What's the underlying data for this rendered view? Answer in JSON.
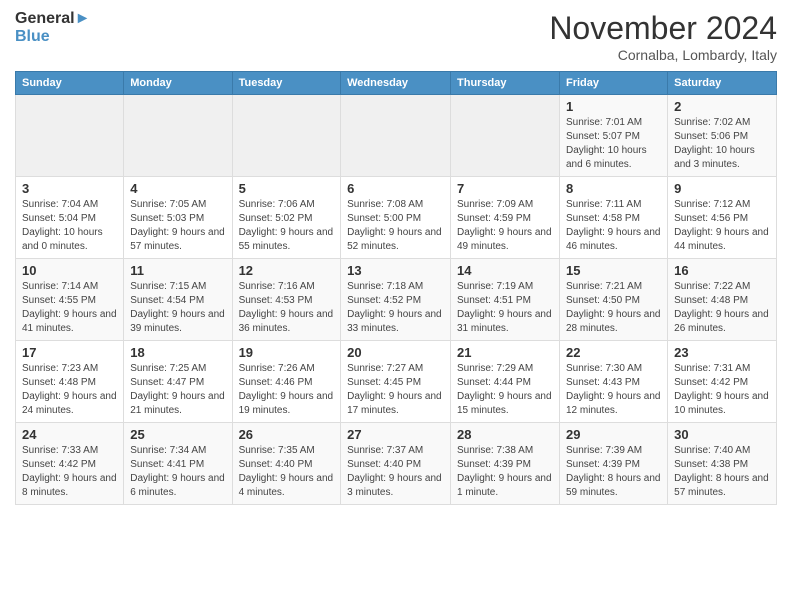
{
  "logo": {
    "line1": "General",
    "line2": "Blue"
  },
  "title": "November 2024",
  "subtitle": "Cornalba, Lombardy, Italy",
  "days_of_week": [
    "Sunday",
    "Monday",
    "Tuesday",
    "Wednesday",
    "Thursday",
    "Friday",
    "Saturday"
  ],
  "weeks": [
    [
      {
        "num": "",
        "info": ""
      },
      {
        "num": "",
        "info": ""
      },
      {
        "num": "",
        "info": ""
      },
      {
        "num": "",
        "info": ""
      },
      {
        "num": "",
        "info": ""
      },
      {
        "num": "1",
        "info": "Sunrise: 7:01 AM\nSunset: 5:07 PM\nDaylight: 10 hours and 6 minutes."
      },
      {
        "num": "2",
        "info": "Sunrise: 7:02 AM\nSunset: 5:06 PM\nDaylight: 10 hours and 3 minutes."
      }
    ],
    [
      {
        "num": "3",
        "info": "Sunrise: 7:04 AM\nSunset: 5:04 PM\nDaylight: 10 hours and 0 minutes."
      },
      {
        "num": "4",
        "info": "Sunrise: 7:05 AM\nSunset: 5:03 PM\nDaylight: 9 hours and 57 minutes."
      },
      {
        "num": "5",
        "info": "Sunrise: 7:06 AM\nSunset: 5:02 PM\nDaylight: 9 hours and 55 minutes."
      },
      {
        "num": "6",
        "info": "Sunrise: 7:08 AM\nSunset: 5:00 PM\nDaylight: 9 hours and 52 minutes."
      },
      {
        "num": "7",
        "info": "Sunrise: 7:09 AM\nSunset: 4:59 PM\nDaylight: 9 hours and 49 minutes."
      },
      {
        "num": "8",
        "info": "Sunrise: 7:11 AM\nSunset: 4:58 PM\nDaylight: 9 hours and 46 minutes."
      },
      {
        "num": "9",
        "info": "Sunrise: 7:12 AM\nSunset: 4:56 PM\nDaylight: 9 hours and 44 minutes."
      }
    ],
    [
      {
        "num": "10",
        "info": "Sunrise: 7:14 AM\nSunset: 4:55 PM\nDaylight: 9 hours and 41 minutes."
      },
      {
        "num": "11",
        "info": "Sunrise: 7:15 AM\nSunset: 4:54 PM\nDaylight: 9 hours and 39 minutes."
      },
      {
        "num": "12",
        "info": "Sunrise: 7:16 AM\nSunset: 4:53 PM\nDaylight: 9 hours and 36 minutes."
      },
      {
        "num": "13",
        "info": "Sunrise: 7:18 AM\nSunset: 4:52 PM\nDaylight: 9 hours and 33 minutes."
      },
      {
        "num": "14",
        "info": "Sunrise: 7:19 AM\nSunset: 4:51 PM\nDaylight: 9 hours and 31 minutes."
      },
      {
        "num": "15",
        "info": "Sunrise: 7:21 AM\nSunset: 4:50 PM\nDaylight: 9 hours and 28 minutes."
      },
      {
        "num": "16",
        "info": "Sunrise: 7:22 AM\nSunset: 4:48 PM\nDaylight: 9 hours and 26 minutes."
      }
    ],
    [
      {
        "num": "17",
        "info": "Sunrise: 7:23 AM\nSunset: 4:48 PM\nDaylight: 9 hours and 24 minutes."
      },
      {
        "num": "18",
        "info": "Sunrise: 7:25 AM\nSunset: 4:47 PM\nDaylight: 9 hours and 21 minutes."
      },
      {
        "num": "19",
        "info": "Sunrise: 7:26 AM\nSunset: 4:46 PM\nDaylight: 9 hours and 19 minutes."
      },
      {
        "num": "20",
        "info": "Sunrise: 7:27 AM\nSunset: 4:45 PM\nDaylight: 9 hours and 17 minutes."
      },
      {
        "num": "21",
        "info": "Sunrise: 7:29 AM\nSunset: 4:44 PM\nDaylight: 9 hours and 15 minutes."
      },
      {
        "num": "22",
        "info": "Sunrise: 7:30 AM\nSunset: 4:43 PM\nDaylight: 9 hours and 12 minutes."
      },
      {
        "num": "23",
        "info": "Sunrise: 7:31 AM\nSunset: 4:42 PM\nDaylight: 9 hours and 10 minutes."
      }
    ],
    [
      {
        "num": "24",
        "info": "Sunrise: 7:33 AM\nSunset: 4:42 PM\nDaylight: 9 hours and 8 minutes."
      },
      {
        "num": "25",
        "info": "Sunrise: 7:34 AM\nSunset: 4:41 PM\nDaylight: 9 hours and 6 minutes."
      },
      {
        "num": "26",
        "info": "Sunrise: 7:35 AM\nSunset: 4:40 PM\nDaylight: 9 hours and 4 minutes."
      },
      {
        "num": "27",
        "info": "Sunrise: 7:37 AM\nSunset: 4:40 PM\nDaylight: 9 hours and 3 minutes."
      },
      {
        "num": "28",
        "info": "Sunrise: 7:38 AM\nSunset: 4:39 PM\nDaylight: 9 hours and 1 minute."
      },
      {
        "num": "29",
        "info": "Sunrise: 7:39 AM\nSunset: 4:39 PM\nDaylight: 8 hours and 59 minutes."
      },
      {
        "num": "30",
        "info": "Sunrise: 7:40 AM\nSunset: 4:38 PM\nDaylight: 8 hours and 57 minutes."
      }
    ]
  ],
  "colors": {
    "header_bg": "#4a90c4",
    "accent": "#4a90c4"
  }
}
